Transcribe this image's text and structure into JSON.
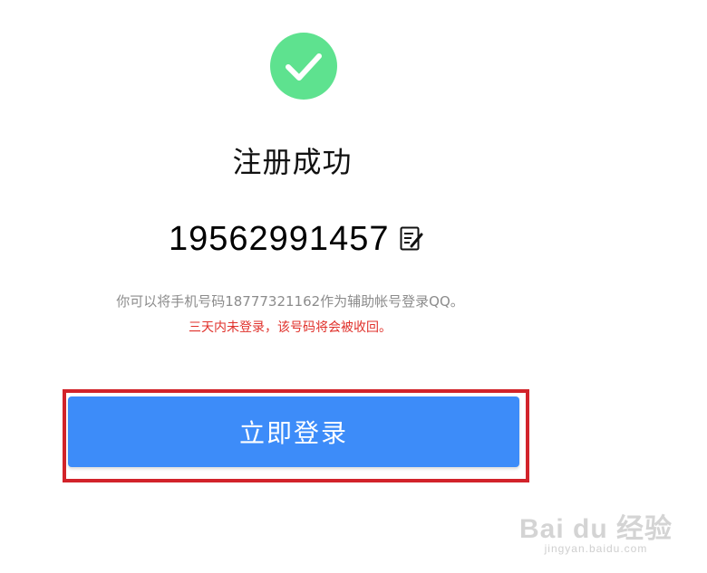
{
  "title": "注册成功",
  "account": {
    "number": "19562991457",
    "edit_icon": "edit-note-icon"
  },
  "hint": "你可以将手机号码18777321162作为辅助帐号登录QQ。",
  "warning": "三天内未登录，该号码将会被收回。",
  "login_button_label": "立即登录",
  "watermark": {
    "logo": "Bai du 经验",
    "url": "jingyan.baidu.com"
  },
  "colors": {
    "success": "#5ee28f",
    "button": "#3d8cf9",
    "warning": "#e0312b",
    "highlight": "#d2232a"
  },
  "icons": [
    "check-icon",
    "edit-note-icon"
  ]
}
